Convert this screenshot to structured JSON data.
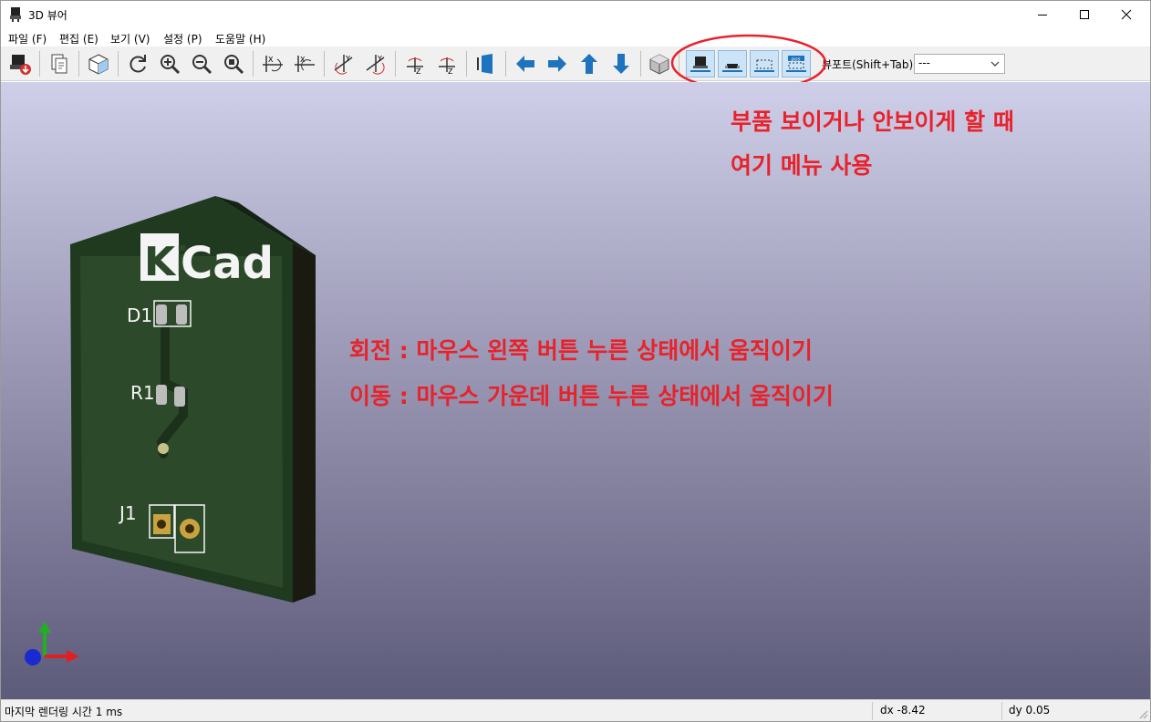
{
  "window": {
    "title": "3D 뷰어"
  },
  "menu": {
    "items": [
      {
        "label": "파일 (F)"
      },
      {
        "label": "편집 (E)"
      },
      {
        "label": "보기 (V)"
      },
      {
        "label": "설정 (P)"
      },
      {
        "label": "도움말 (H)"
      }
    ]
  },
  "toolbar": {
    "viewport_label": "뷰포트(Shift+Tab):",
    "viewport_value": "---"
  },
  "board": {
    "logo_ki": "Ki",
    "logo_cad": "Cad",
    "ref_d1": "D1",
    "ref_r1": "R1",
    "ref_j1": "J1"
  },
  "annotations": {
    "toolbar_note_line1": "부품 보이거나 안보이게 할 때",
    "toolbar_note_line2": "여기 메뉴 사용",
    "rotate_note": "회전 : 마우스 왼쪽 버튼 누른 상태에서 움직이기",
    "pan_note": "이동 : 마우스 가운데 버튼 누른 상태에서 움직이기",
    "highlight_color": "#e8222b"
  },
  "status": {
    "render_time": "마지막 렌더링 시간 1 ms",
    "dx": "dx -8.42",
    "dy": "dy 0.05"
  }
}
